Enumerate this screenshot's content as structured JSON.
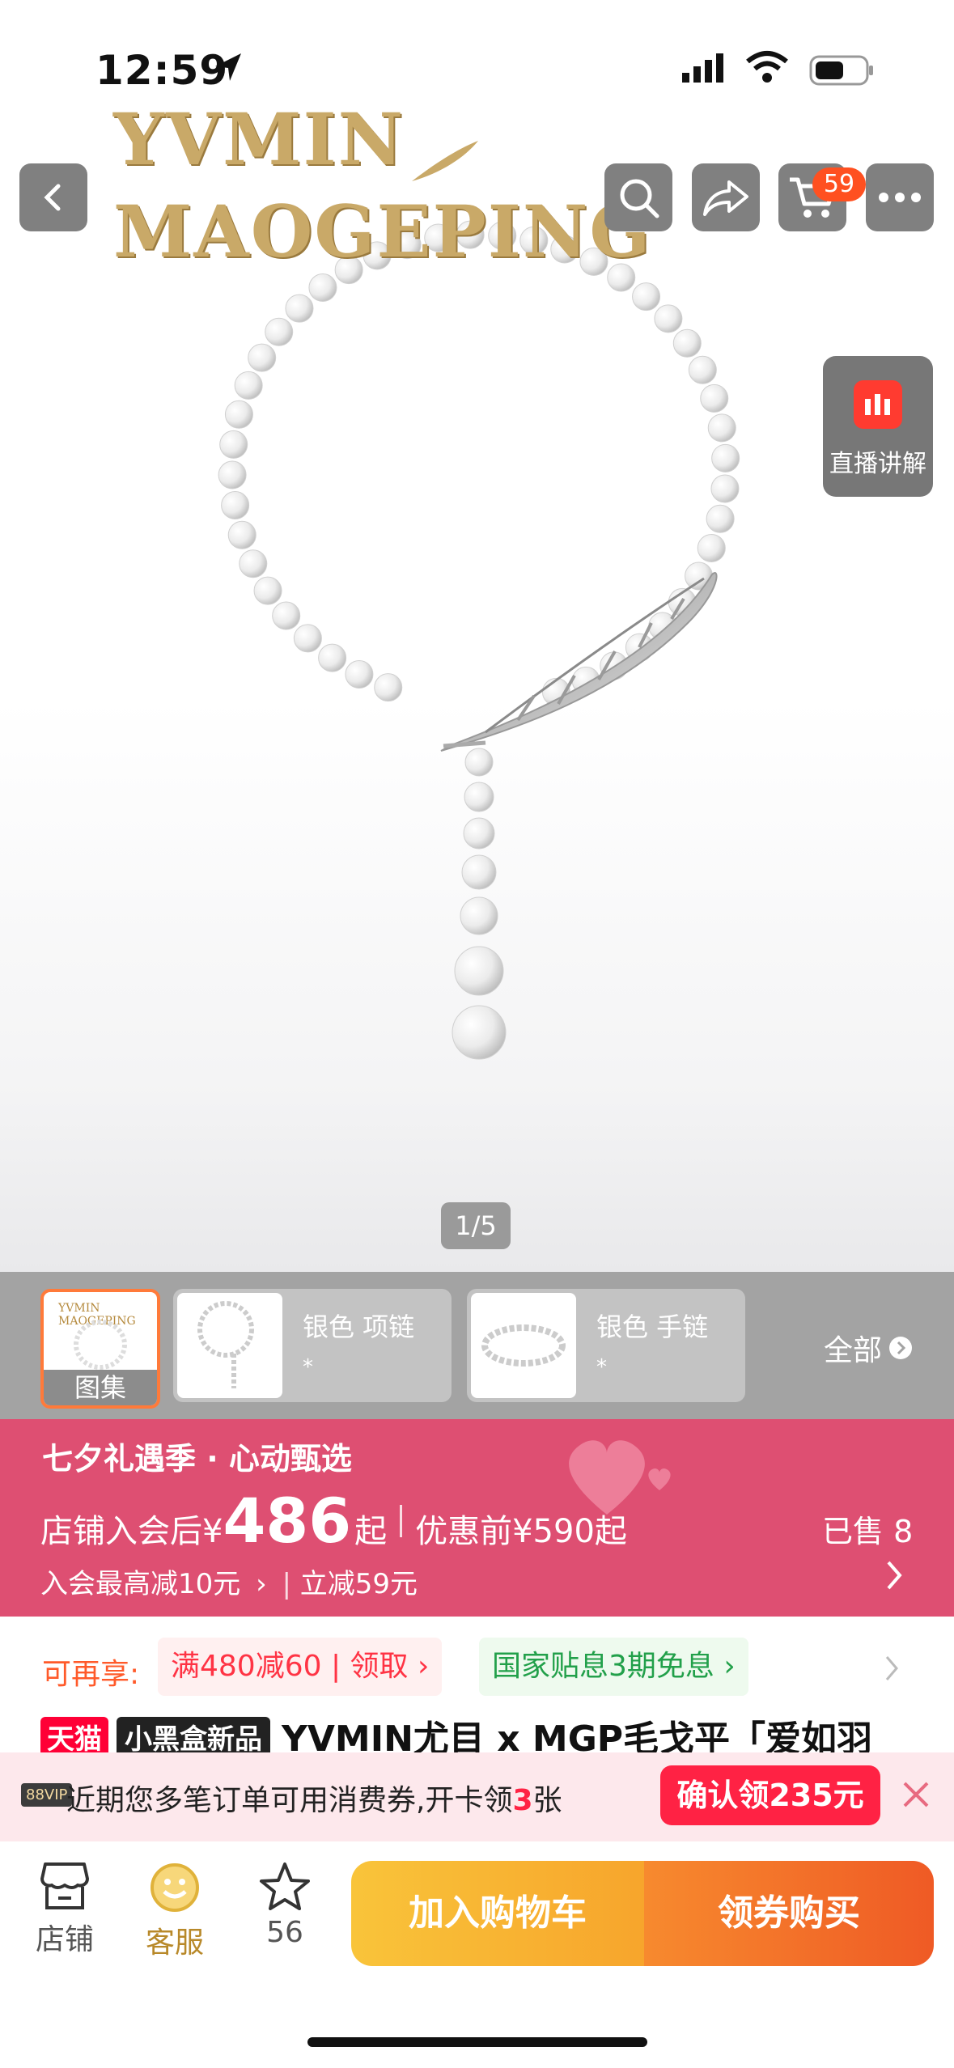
{
  "status_bar": {
    "time": "12:59"
  },
  "brand": {
    "left": "YVMIN",
    "right": "MAOGEPING"
  },
  "nav": {
    "cart_count": "59"
  },
  "live": {
    "label": "直播讲解"
  },
  "gallery": {
    "indicator": "1/5"
  },
  "variants": {
    "main_label": "图集",
    "main_logo": "YVMIN MAOGEPING",
    "items": [
      {
        "name": "银色 项链",
        "sub": "*"
      },
      {
        "name": "银色 手链",
        "sub": "*"
      }
    ],
    "all_label": "全部"
  },
  "promo": {
    "title": "七夕礼遇季 · 心动甄选",
    "price_prefix": "店铺入会后¥",
    "price": "486",
    "price_suffix": "起",
    "original": "优惠前¥590起",
    "sold": "已售 8",
    "sub1": "入会最高减10元",
    "sub2": "立减59元"
  },
  "coupons": {
    "label": "可再享:",
    "red": "满480减60 | 领取",
    "green": "国家贴息3期免息"
  },
  "product": {
    "tag_tmall": "天猫",
    "tag_new": "小黑盒新品",
    "title": "YVMIN尤目 x MGP毛戈平「爱如羽"
  },
  "notice": {
    "vip": "88VIP",
    "text_before": "近期您多笔订单可用消费券,开卡领",
    "count": "3",
    "text_after": "张",
    "button": "确认领235元"
  },
  "bottom": {
    "shop": "店铺",
    "service": "客服",
    "fav_count": "56",
    "add_cart": "加入购物车",
    "buy": "领券购买"
  },
  "colors": {
    "promo_bg": "#de4f72",
    "accent_red": "#ff2244",
    "cart_btn": "#f9c43a",
    "buy_btn": "#ef5a25"
  }
}
